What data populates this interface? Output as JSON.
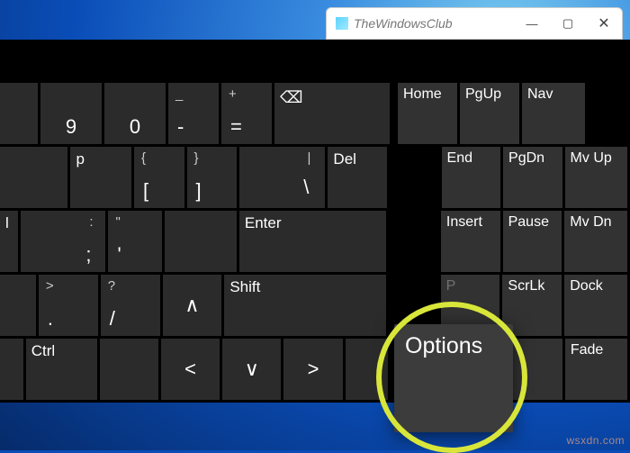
{
  "window": {
    "title": "TheWindowsClub",
    "min": "—",
    "max": "▢",
    "close": "✕"
  },
  "keys": {
    "r1": {
      "nine": "9",
      "zero": "0",
      "dash_top": "_",
      "dash": "-",
      "eq_top": "+",
      "eq": "=",
      "bksp": "⌫",
      "home": "Home",
      "pgup": "PgUp",
      "nav": "Nav"
    },
    "r2": {
      "p": "p",
      "lb_top": "{",
      "lb": "[",
      "rb_top": "}",
      "rb": "]",
      "bs_top": "|",
      "bs": "\\",
      "del": "Del",
      "end": "End",
      "pgdn": "PgDn",
      "mvup": "Mv Up"
    },
    "r3": {
      "l": "l",
      "sc_top": ":",
      "sc": ";",
      "qt_top": "\"",
      "qt": "'",
      "enter": "Enter",
      "ins": "Insert",
      "pause": "Pause",
      "mvdn": "Mv Dn"
    },
    "r4": {
      "dot_top": ">",
      "dot": ".",
      "sl_top": "?",
      "sl": "/",
      "up": "∧",
      "shift": "Shift",
      "p_obscured": "P",
      "scrlk": "ScrLk",
      "dock": "Dock"
    },
    "r5": {
      "ctrl": "Ctrl",
      "left": "<",
      "down": "∨",
      "right": ">",
      "fade": "Fade"
    }
  },
  "options": "Options",
  "watermark": "wsxdn.com"
}
